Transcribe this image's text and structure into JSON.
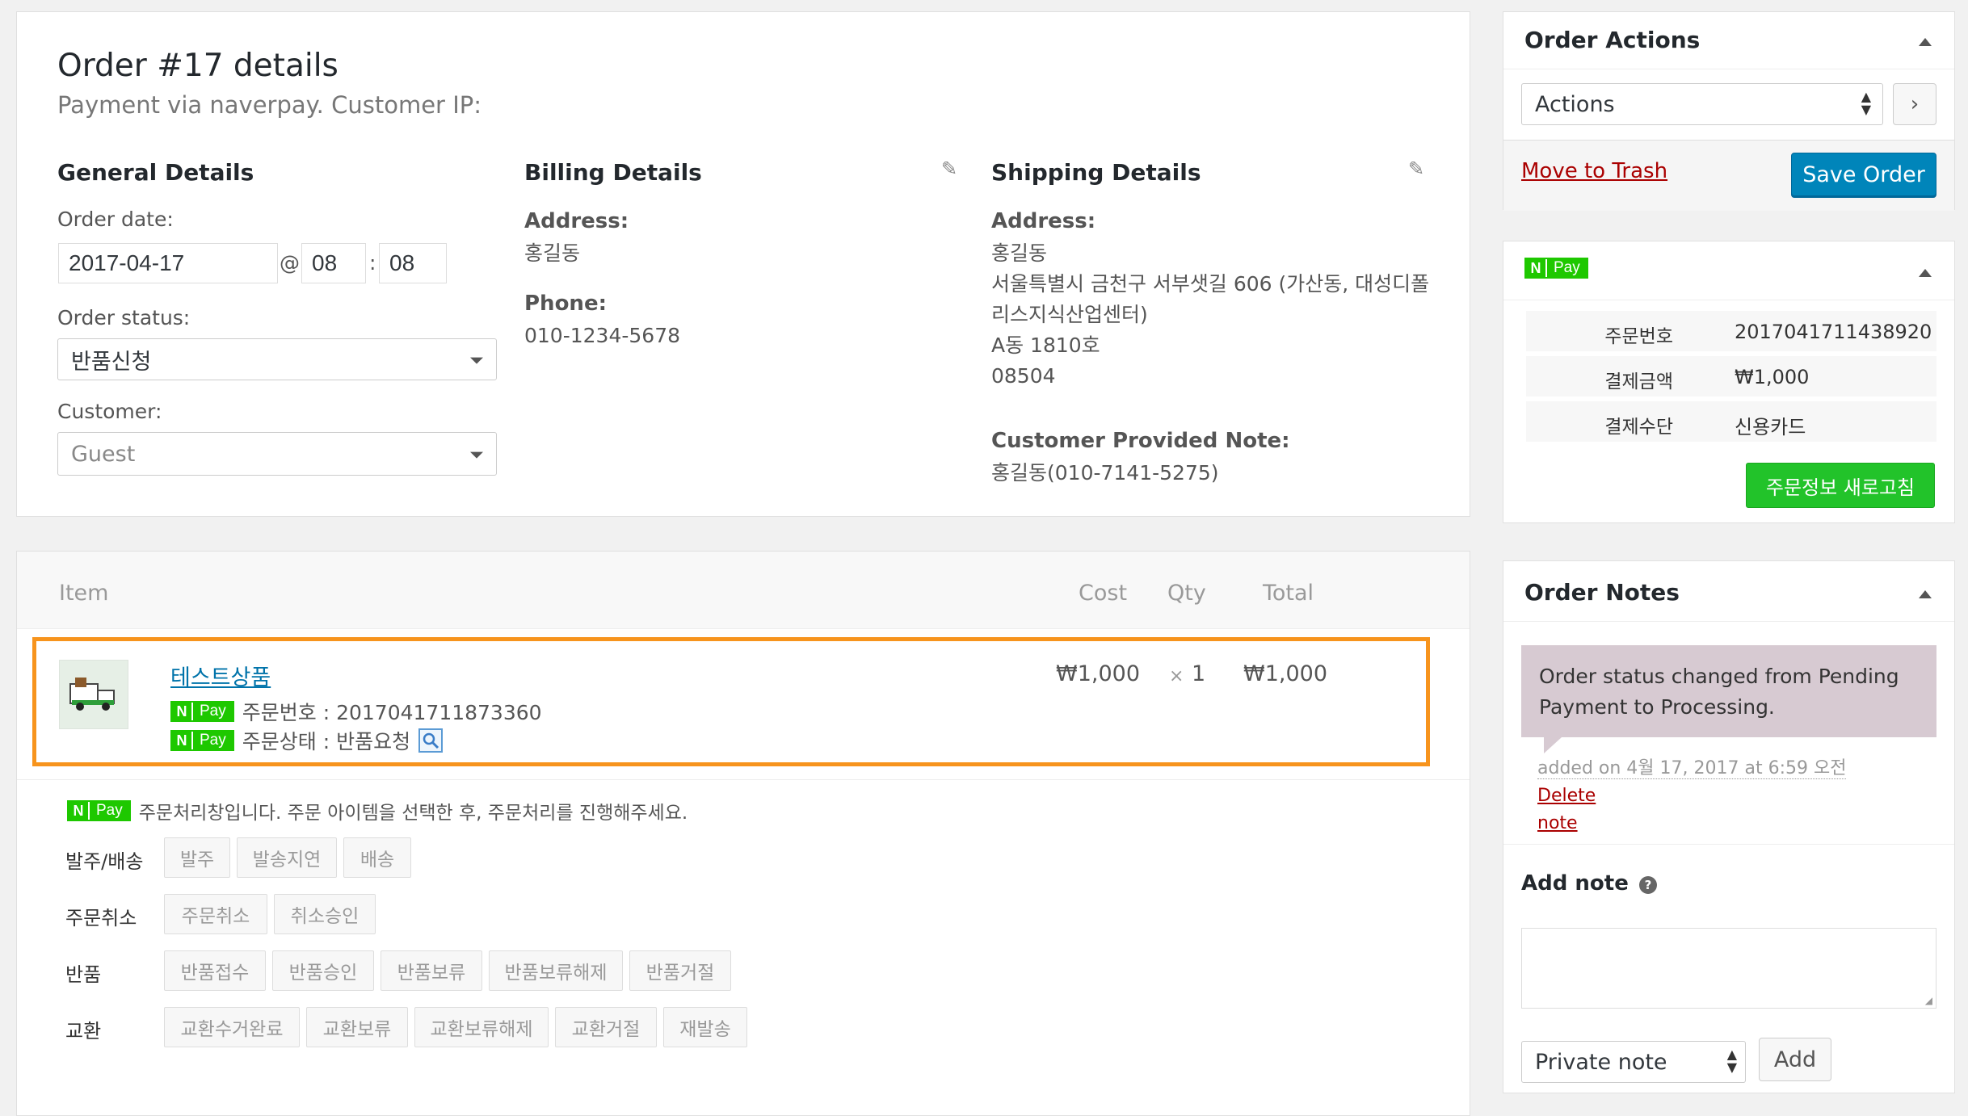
{
  "order": {
    "title": "Order #17 details",
    "subtitle": "Payment via naverpay. Customer IP:"
  },
  "general": {
    "heading": "General Details",
    "order_date_label": "Order date:",
    "order_date": "2017-04-17",
    "at": "@",
    "hour": "08",
    "colon": ":",
    "minute": "08",
    "status_label": "Order status:",
    "status_value": "반품신청",
    "customer_label": "Customer:",
    "customer_value": "Guest"
  },
  "billing": {
    "heading": "Billing Details",
    "address_label": "Address:",
    "address": "홍길동",
    "phone_label": "Phone:",
    "phone": "010-1234-5678"
  },
  "shipping": {
    "heading": "Shipping Details",
    "address_label": "Address:",
    "address_lines": [
      "홍길동",
      "서울특별시 금천구 서부샛길 606 (가산동, 대성디폴",
      "리스지식산업센터)",
      "A동 1810호",
      "08504"
    ],
    "note_label": "Customer Provided Note:",
    "note": "홍길동(010-7141-5275)"
  },
  "items": {
    "headers": {
      "item": "Item",
      "cost": "Cost",
      "qty": "Qty",
      "total": "Total"
    },
    "product": {
      "name": "테스트상품",
      "cost": "₩1,000",
      "qty_x": "×",
      "qty": "1",
      "total": "₩1,000",
      "order_no_meta": "주문번호 : 2017041711873360",
      "status_meta": "주문상태 : 반품요청"
    },
    "npay": {
      "n": "N",
      "pay": "Pay"
    },
    "process_notice": "주문처리창입니다. 주문 아이템을 선택한 후, 주문처리를 진행해주세요.",
    "action_rows": [
      {
        "label": "발주/배송",
        "buttons": [
          "발주",
          "발송지연",
          "배송"
        ]
      },
      {
        "label": "주문취소",
        "buttons": [
          "주문취소",
          "취소승인"
        ]
      },
      {
        "label": "반품",
        "buttons": [
          "반품접수",
          "반품승인",
          "반품보류",
          "반품보류해제",
          "반품거절"
        ]
      },
      {
        "label": "교환",
        "buttons": [
          "교환수거완료",
          "교환보류",
          "교환보류해제",
          "교환거절",
          "재발송"
        ]
      }
    ]
  },
  "order_actions": {
    "heading": "Order Actions",
    "select_value": "Actions",
    "trash": "Move to Trash",
    "save": "Save Order"
  },
  "npay_box": {
    "rows": [
      {
        "k": "주문번호",
        "v": "2017041711438920"
      },
      {
        "k": "결제금액",
        "v": "₩1,000"
      },
      {
        "k": "결제수단",
        "v": "신용카드"
      }
    ],
    "refresh": "주문정보 새로고침"
  },
  "notes": {
    "heading": "Order Notes",
    "note_text": "Order status changed from Pending Payment to Processing.",
    "note_meta": "added on 4월 17, 2017 at 6:59 오전",
    "delete": "Delete",
    "delete2": "note",
    "add_label": "Add note",
    "help": "?",
    "type_value": "Private note",
    "add_button": "Add"
  },
  "colors": {
    "highlight": "#f7941d",
    "npay_green": "#1ec800",
    "primary_blue": "#0085ba"
  }
}
